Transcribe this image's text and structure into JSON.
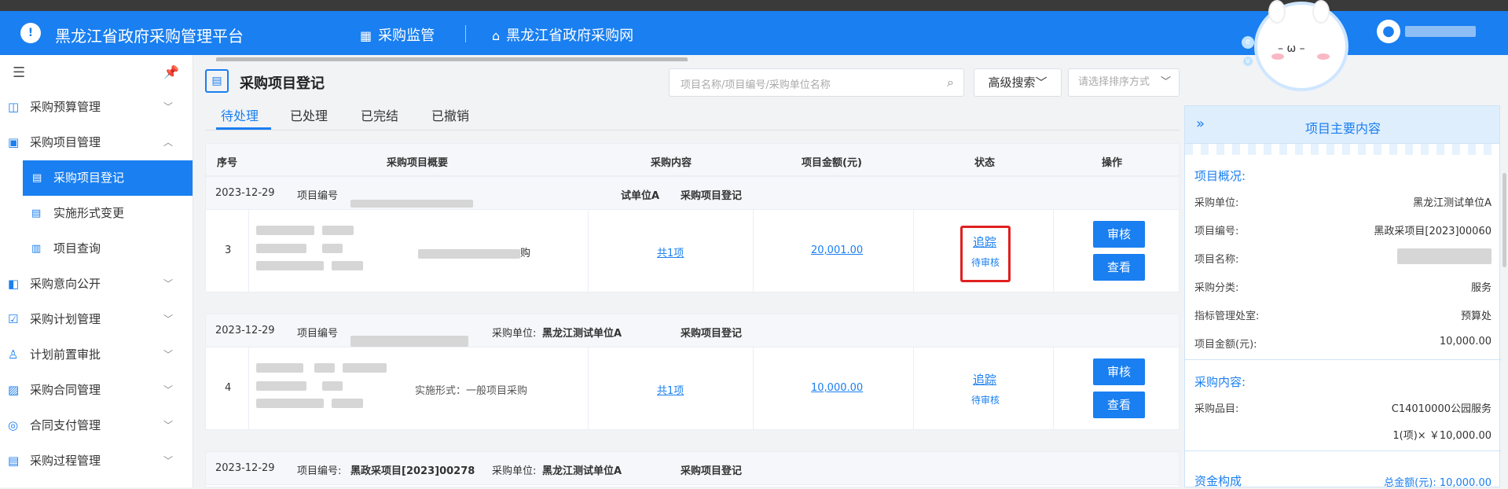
{
  "header": {
    "logo_text": "!",
    "app_title": "黑龙江省政府采购管理平台",
    "nav1": "采购监管",
    "nav2": "黑龙江省政府采购网"
  },
  "sidebar": {
    "items": [
      {
        "label": "采购预算管理"
      },
      {
        "label": "采购项目管理"
      },
      {
        "label": "采购项目登记"
      },
      {
        "label": "实施形式变更"
      },
      {
        "label": "项目查询"
      },
      {
        "label": "采购意向公开"
      },
      {
        "label": "采购计划管理"
      },
      {
        "label": "计划前置审批"
      },
      {
        "label": "采购合同管理"
      },
      {
        "label": "合同支付管理"
      },
      {
        "label": "采购过程管理"
      }
    ]
  },
  "page": {
    "title": "采购项目登记",
    "search_placeholder": "项目名称/项目编号/采购单位名称",
    "advanced_search": "高级搜索",
    "sort_placeholder": "请选择排序方式"
  },
  "tabs": [
    "待处理",
    "已处理",
    "已完结",
    "已撤销"
  ],
  "table": {
    "headers": [
      "序号",
      "采购项目概要",
      "采购内容",
      "项目金额(元)",
      "状态",
      "操作"
    ],
    "groups": [
      {
        "date": "2023-12-29",
        "code_label": "项目编号",
        "unit_tail": "试单位A",
        "type": "采购项目登记",
        "index": "3",
        "summary_tail": "购",
        "content": "共1项",
        "amount": "20,001.00",
        "track": "追踪",
        "status": "待审核",
        "btn_review": "审核",
        "btn_view": "查看"
      },
      {
        "date": "2023-12-29",
        "code_label": "项目编号",
        "unit_label": "采购单位:",
        "unit": "黑龙江测试单位A",
        "type": "采购项目登记",
        "index": "4",
        "summary_tail": "实施形式：一般项目采购",
        "content": "共1项",
        "amount": "10,000.00",
        "track": "追踪",
        "status": "待审核",
        "btn_review": "审核",
        "btn_view": "查看"
      },
      {
        "date": "2023-12-29",
        "code_label": "项目编号:",
        "code": "黑政采项目[2023]00278",
        "unit_label": "采购单位:",
        "unit": "黑龙江测试单位A",
        "type": "采购项目登记"
      }
    ]
  },
  "right_panel": {
    "title": "项目主要内容",
    "overview_title": "项目概况:",
    "rows": [
      {
        "label": "采购单位:",
        "value": "黑龙江测试单位A"
      },
      {
        "label": "项目编号:",
        "value": "黑政采项目[2023]00060"
      },
      {
        "label": "项目名称:",
        "value": ""
      },
      {
        "label": "采购分类:",
        "value": "服务"
      },
      {
        "label": "指标管理处室:",
        "value": "预算处"
      },
      {
        "label": "项目金额(元):",
        "value": "10,000.00"
      }
    ],
    "content_title": "采购内容:",
    "item_label": "采购品目:",
    "item_value": "C14010000公园服务",
    "item_qty": "1(项)× ￥10,000.00",
    "fund_title": "资金构成",
    "fund_total": "总金额(元): 10,000.00"
  },
  "colors": {
    "primary": "#1a7ff0",
    "highlight_box": "#e02020"
  }
}
